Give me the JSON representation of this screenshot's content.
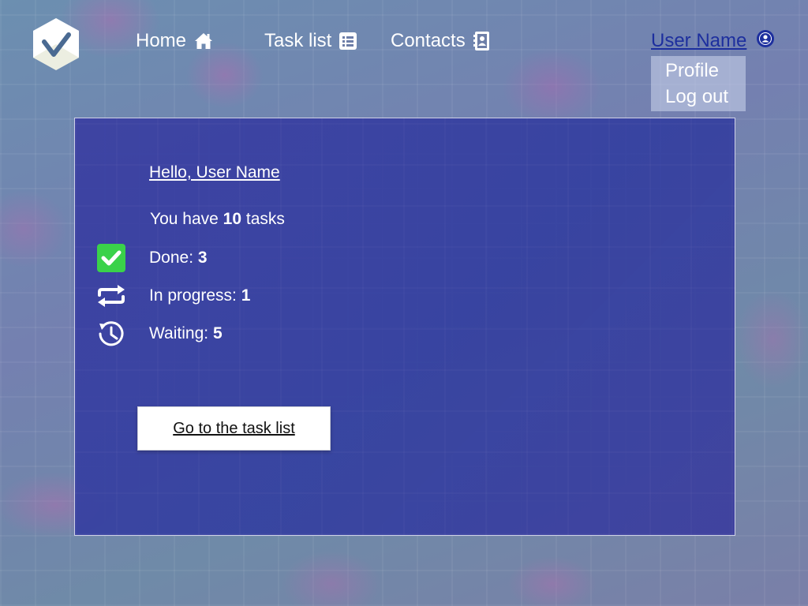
{
  "nav": {
    "items": [
      {
        "label": "Home",
        "icon": "home-icon"
      },
      {
        "label": "Task list",
        "icon": "list-icon"
      },
      {
        "label": "Contacts",
        "icon": "address-book-icon"
      }
    ]
  },
  "user": {
    "name": "User Name",
    "icon": "user-circle-icon",
    "menu": [
      "Profile",
      "Log out"
    ]
  },
  "main": {
    "greeting": "Hello, User Name",
    "summary": {
      "prefix": "You have",
      "count": "10",
      "suffix": "tasks"
    },
    "stats": [
      {
        "label": "Done:",
        "value": "3",
        "icon": "check-square-icon"
      },
      {
        "label": "In progress:",
        "value": "1",
        "icon": "repeat-icon"
      },
      {
        "label": "Waiting:",
        "value": "5",
        "icon": "history-clock-icon"
      }
    ],
    "button_label": "Go to the task list"
  },
  "colors": {
    "panel": "#3a3ea2",
    "user_link": "#1d2f9e",
    "done_check": "#3ad24a",
    "logo_check": "#4a6a92"
  }
}
